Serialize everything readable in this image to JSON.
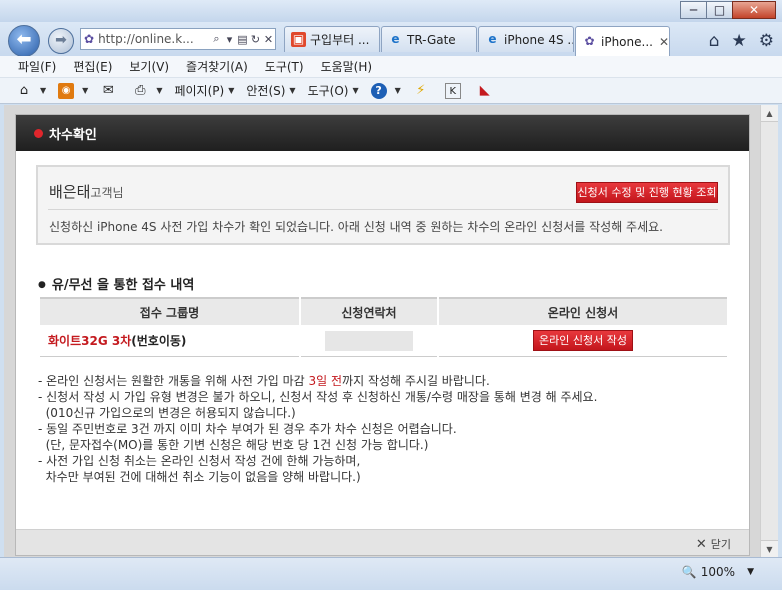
{
  "window": {
    "buttons": [
      "─",
      "□",
      "✕"
    ]
  },
  "address_bar": {
    "url": "http://online.k..."
  },
  "tabs": [
    {
      "label": "구입부터 ...",
      "icon": "gift-icon"
    },
    {
      "label": "TR-Gate",
      "icon": "ie-icon"
    },
    {
      "label": "iPhone 4S ...",
      "icon": "ie-icon"
    },
    {
      "label": "iPhone...",
      "icon": "flower-icon",
      "active": true
    }
  ],
  "menu": [
    "파일(F)",
    "편집(E)",
    "보기(V)",
    "즐겨찾기(A)",
    "도구(T)",
    "도움말(H)"
  ],
  "commandbar": {
    "page": "페이지(P)",
    "safety": "안전(S)",
    "tools": "도구(O)"
  },
  "popup": {
    "header_title": "차수확인",
    "user_name": "배은태",
    "user_suffix": "고객님",
    "status_button": "신청서 수정 및 진행 현황 조회",
    "message": "신청하신 iPhone 4S 사전 가입 차수가 확인 되었습니다. 아래 신청 내역 중 원하는 차수의 온라인 신청서를 작성해 주세요.",
    "section_title": "유/무선 을 통한 접수 내역",
    "table": {
      "headers": [
        "접수 그룹명",
        "신청연락처",
        "온라인 신청서"
      ],
      "rows": [
        {
          "group_red": "화이트32G 3차",
          "group_rest": "(번호이동)",
          "contact": "",
          "action": "온라인 신청서 작성"
        }
      ]
    },
    "notes": {
      "line1_pre": "- 온라인 신청서는 원활한 개통을 위해 사전 가입 마감 ",
      "line1_red": "3일 전",
      "line1_post": "까지 작성해 주시길 바랍니다.",
      "rest": "- 신청서 작성 시 가입 유형 변경은 불가 하오니, 신청서 작성 후 신청하신 개통/수령 매장을 통해 변경 해 주세요.\n  (010신규 가입으로의 변경은 허용되지 않습니다.)\n- 동일 주민번호로 3건 까지 이미 차수 부여가 된 경우 추가 차수 신청은 어렵습니다.\n  (단, 문자접수(MO)를 통한 기변 신청은 해당 번호 당 1건 신청 가능 합니다.)\n- 사전 가입 신청 취소는 온라인 신청서 작성 건에 한해 가능하며,\n  차수만 부여된 건에 대해선 취소 기능이 없음을 양해 바랍니다.)"
    },
    "close_label": "닫기"
  },
  "statusbar": {
    "zoom": "100%"
  }
}
